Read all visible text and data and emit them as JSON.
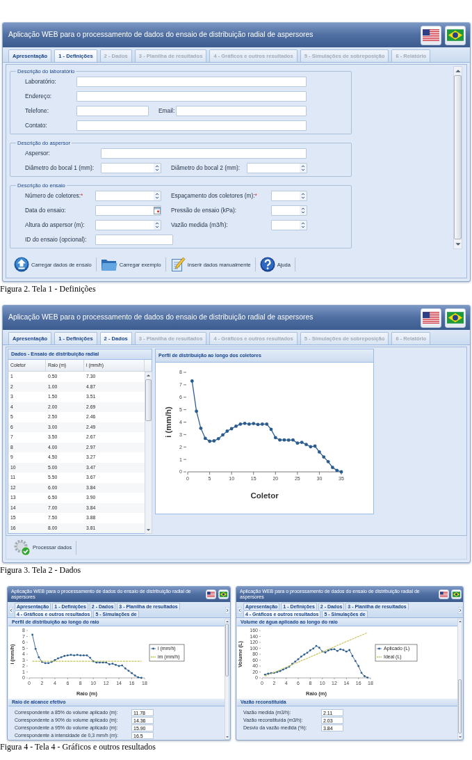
{
  "figures": [
    {
      "kind": "form",
      "window": {
        "title": "Aplicação WEB para o processamento de dados do ensaio de distribuição radial de aspersores"
      },
      "tabs": [
        {
          "label": "Apresentação",
          "selected": false,
          "disabled": false
        },
        {
          "label": "1 - Definições",
          "selected": true,
          "disabled": false
        },
        {
          "label": "2 - Dados",
          "selected": false,
          "disabled": true
        },
        {
          "label": "3 - Planilha de resultados",
          "selected": false,
          "disabled": true
        },
        {
          "label": "4 - Gráficos e outros resultados",
          "selected": false,
          "disabled": true
        },
        {
          "label": "5 - Simulações de sobreposição",
          "selected": false,
          "disabled": true
        },
        {
          "label": "6 - Relatório",
          "selected": false,
          "disabled": true
        }
      ],
      "fieldsets": [
        {
          "legend": "Descrição do laboratório",
          "rows": [
            [
              {
                "label": "Laboratório:",
                "kind": "text"
              }
            ],
            [
              {
                "label": "Endereço:",
                "kind": "text"
              }
            ],
            [
              {
                "label": "Telefone:",
                "kind": "text"
              },
              {
                "label": "Email:",
                "kind": "text"
              }
            ],
            [
              {
                "label": "Contato:",
                "kind": "text"
              }
            ]
          ]
        },
        {
          "legend": "Descrição do aspersor",
          "rows": [
            [
              {
                "label": "Aspersor:",
                "kind": "text"
              }
            ],
            [
              {
                "label": "Diâmetro do bocal 1 (mm):",
                "kind": "spinner"
              },
              {
                "label": "Diâmetro do bocal 2 (mm):",
                "kind": "spinner"
              }
            ]
          ]
        },
        {
          "legend": "Descrição do ensaio",
          "rows": [
            [
              {
                "label": "Número de coletores:",
                "required_mark": "*",
                "kind": "spinner"
              },
              {
                "label": "Espaçamento dos coletores (m):",
                "required_mark": "*",
                "kind": "spinner"
              }
            ],
            [
              {
                "label": "Data do ensaio:",
                "kind": "date"
              },
              {
                "label": "Pressão de ensaio (kPa):",
                "kind": "spinner"
              }
            ],
            [
              {
                "label": "Altura do aspersor (m):",
                "kind": "spinner"
              },
              {
                "label": "Vazão medida (m3/h):",
                "kind": "spinner"
              }
            ],
            [
              {
                "label": "ID do ensaio (opcional):",
                "kind": "text"
              }
            ]
          ]
        }
      ],
      "toolbar": [
        "Carregar dados de ensaio",
        "Carregar exemplo",
        "Inserir dados manualmente",
        "Ajuda"
      ],
      "caption": "Figura 2. Tela 1 - Definições"
    },
    {
      "kind": "data",
      "window": {
        "title": "Aplicação WEB para o processamento de dados do ensaio de distribuição radial de aspersores"
      },
      "tabs": [
        {
          "label": "Apresentação",
          "selected": false,
          "disabled": false
        },
        {
          "label": "1 - Definições",
          "selected": false,
          "disabled": false
        },
        {
          "label": "2 - Dados",
          "selected": true,
          "disabled": false
        },
        {
          "label": "3 - Planilha de resultados",
          "selected": false,
          "disabled": true
        },
        {
          "label": "4 - Gráficos e outros resultados",
          "selected": false,
          "disabled": true
        },
        {
          "label": "5 - Simulações de sobreposição",
          "selected": false,
          "disabled": true
        },
        {
          "label": "6 - Relatório",
          "selected": false,
          "disabled": true
        }
      ],
      "data_grid": {
        "title": "Dados - Ensaio de distribuição radial",
        "columns": [
          "Coletor",
          "Raio (m)",
          "i (mm/h)"
        ],
        "rows": [
          [
            "1",
            "0.50",
            "7.30"
          ],
          [
            "2",
            "1.00",
            "4.87"
          ],
          [
            "3",
            "1.50",
            "3.51"
          ],
          [
            "4",
            "2.00",
            "2.69"
          ],
          [
            "5",
            "2.50",
            "2.46"
          ],
          [
            "6",
            "3.00",
            "2.49"
          ],
          [
            "7",
            "3.50",
            "2.67"
          ],
          [
            "8",
            "4.00",
            "2.97"
          ],
          [
            "9",
            "4.50",
            "3.27"
          ],
          [
            "10",
            "5.00",
            "3.47"
          ],
          [
            "11",
            "5.50",
            "3.67"
          ],
          [
            "12",
            "6.00",
            "3.84"
          ],
          [
            "13",
            "6.50",
            "3.90"
          ],
          [
            "14",
            "7.00",
            "3.84"
          ],
          [
            "15",
            "7.50",
            "3.88"
          ],
          [
            "16",
            "8.00",
            "3.81"
          ]
        ]
      },
      "chart_panel": {
        "title": "Perfil de distribuição ao longo dos coletores",
        "chart_data": {
          "type": "line",
          "xlabel": "Coletor",
          "ylabel": "i (mm/h)",
          "x": [
            1,
            2,
            3,
            4,
            5,
            6,
            7,
            8,
            9,
            10,
            11,
            12,
            13,
            14,
            15,
            16,
            17,
            18,
            19,
            20,
            21,
            22,
            23,
            24,
            25,
            26,
            27,
            28,
            29,
            30,
            31,
            32,
            33,
            34,
            35
          ],
          "series": [
            {
              "color": "#2b5c8f",
              "values": [
                7.3,
                4.87,
                3.51,
                2.69,
                2.46,
                2.49,
                2.67,
                2.97,
                3.27,
                3.47,
                3.67,
                3.84,
                3.9,
                3.84,
                3.88,
                3.81,
                3.84,
                3.84,
                3.42,
                2.75,
                2.56,
                2.56,
                2.55,
                2.56,
                2.31,
                2.37,
                2.2,
                2.02,
                2.07,
                1.6,
                1.2,
                0.82,
                0.35,
                0.12,
                0
              ]
            }
          ],
          "xlim": [
            0,
            35
          ],
          "ylim": [
            0,
            8
          ],
          "xticks": [
            0,
            5,
            10,
            15,
            20,
            25,
            30,
            35
          ],
          "yticks": [
            0,
            1,
            2,
            3,
            4,
            5,
            6,
            7,
            8
          ]
        }
      },
      "toolbar": [
        "Processar dados"
      ],
      "caption": "Figura 3. Tela 2 - Dados"
    },
    {
      "kind": "charts",
      "screens": [
        {
          "window": {
            "title": "Aplicação WEB para o processamento de dados do ensaio de distribuição radial de aspersores"
          },
          "tabs": [
            {
              "label": "Apresentação",
              "selected": false,
              "disabled": false
            },
            {
              "label": "1 - Definições",
              "selected": false,
              "disabled": false
            },
            {
              "label": "2 - Dados",
              "selected": false,
              "disabled": false
            },
            {
              "label": "3 - Planilha de resultados",
              "selected": false,
              "disabled": false
            },
            {
              "label": "4 - Gráficos e outros resultados",
              "selected": true,
              "disabled": false
            },
            {
              "label": "5 - Simulações de",
              "selected": false,
              "disabled": false
            }
          ],
          "chart_panel": {
            "title": "Perfil de distribuição ao longo do raio",
            "chart_data": {
              "type": "line",
              "xlabel": "Raio (m)",
              "ylabel": "i (mm/h)",
              "x": [
                0.5,
                1,
                1.5,
                2,
                2.5,
                3,
                3.5,
                4,
                4.5,
                5,
                5.5,
                6,
                6.5,
                7,
                7.5,
                8,
                8.5,
                9,
                9.5,
                10,
                10.5,
                11,
                11.5,
                12,
                12.5,
                13,
                13.5,
                14,
                14.5,
                15,
                15.5,
                16,
                16.5,
                17,
                17.5
              ],
              "series": [
                {
                  "name": "i (mm/h)",
                  "color": "#2b5c8f",
                  "values": [
                    7.3,
                    4.9,
                    3.5,
                    2.7,
                    2.5,
                    2.5,
                    2.7,
                    3.0,
                    3.3,
                    3.5,
                    3.7,
                    3.8,
                    3.9,
                    3.8,
                    3.9,
                    3.8,
                    3.8,
                    3.8,
                    3.4,
                    2.8,
                    2.6,
                    2.6,
                    2.6,
                    2.6,
                    2.3,
                    2.4,
                    2.2,
                    2.0,
                    2.1,
                    1.6,
                    1.2,
                    0.8,
                    0.4,
                    0.1,
                    0
                  ]
                },
                {
                  "name": "im (mm/h)",
                  "color": "#c2c24e",
                  "line_style": "dashed",
                  "values": [
                    2.8,
                    2.8,
                    2.8,
                    2.8,
                    2.8,
                    2.8,
                    2.8,
                    2.8,
                    2.8,
                    2.8,
                    2.8,
                    2.8,
                    2.8,
                    2.8,
                    2.8,
                    2.8,
                    2.8,
                    2.8,
                    2.8,
                    2.8,
                    2.8,
                    2.8,
                    2.8,
                    2.8,
                    2.8,
                    2.8,
                    2.8,
                    2.8,
                    2.8,
                    2.8,
                    2.8,
                    2.8,
                    2.8,
                    2.8,
                    2.8
                  ]
                }
              ],
              "xlim": [
                0,
                18
              ],
              "ylim": [
                0,
                8
              ],
              "xticks": [
                0,
                2,
                4,
                6,
                8,
                10,
                12,
                14,
                16,
                18
              ],
              "yticks": [
                0,
                1,
                2,
                3,
                4,
                5,
                6,
                7,
                8
              ],
              "legend": "right"
            }
          },
          "results_panel": {
            "title": "Raio de alcance efetivo",
            "fields": [
              {
                "label": "Correspondente a 85% do volume aplicado (m):",
                "value": "11.78"
              },
              {
                "label": "Correspondente a 90% do volume aplicado (m):",
                "value": "14.36"
              },
              {
                "label": "Correspondente a 95% do volume aplicado (m):",
                "value": "15.90"
              },
              {
                "label": "Correspondente à intensidade de 0,3 mm/h (m):",
                "value": "16.5"
              }
            ]
          }
        },
        {
          "window": {
            "title": "Aplicação WEB para o processamento de dados do ensaio de distribuição radial de aspersores"
          },
          "tabs": [
            {
              "label": "Apresentação",
              "selected": false,
              "disabled": false
            },
            {
              "label": "1 - Definições",
              "selected": false,
              "disabled": false
            },
            {
              "label": "2 - Dados",
              "selected": false,
              "disabled": false
            },
            {
              "label": "3 - Planilha de resultados",
              "selected": false,
              "disabled": false
            },
            {
              "label": "4 - Gráficos e outros resultados",
              "selected": true,
              "disabled": false
            },
            {
              "label": "5 - Simulações de",
              "selected": false,
              "disabled": false
            }
          ],
          "chart_panel": {
            "title": "Volume de água aplicado ao longo do raio",
            "chart_data": {
              "type": "line",
              "xlabel": "Raio (m)",
              "ylabel": "Volume (L)",
              "x": [
                0.5,
                1,
                1.5,
                2,
                2.5,
                3,
                3.5,
                4,
                4.5,
                5,
                5.5,
                6,
                6.5,
                7,
                7.5,
                8,
                8.5,
                9,
                9.5,
                10,
                10.5,
                11,
                11.5,
                12,
                12.5,
                13,
                13.5,
                14,
                14.5,
                15,
                15.5,
                16,
                16.5,
                17,
                17.5
              ],
              "series": [
                {
                  "name": "Aplicado (L)",
                  "color": "#2b5c8f",
                  "values": [
                    11,
                    14,
                    16,
                    17,
                    20,
                    23,
                    28,
                    33,
                    38,
                    47,
                    55,
                    63,
                    72,
                    79,
                    85,
                    93,
                    99,
                    108,
                    102,
                    89,
                    86,
                    93,
                    96,
                    97,
                    91,
                    97,
                    94,
                    89,
                    94,
                    74,
                    57,
                    40,
                    17,
                    6,
                    1
                  ]
                },
                {
                  "name": "Ideal (L)",
                  "color": "#c8c35a",
                  "line_style": "dashed",
                  "values": [
                    6,
                    10,
                    14,
                    19,
                    23,
                    27,
                    32,
                    36,
                    40,
                    45,
                    49,
                    53,
                    58,
                    62,
                    66,
                    71,
                    75,
                    79,
                    84,
                    88,
                    92,
                    97,
                    101,
                    105,
                    110,
                    114,
                    118,
                    123,
                    127,
                    131,
                    136,
                    140,
                    144,
                    149,
                    153
                  ]
                }
              ],
              "xlim": [
                0,
                18
              ],
              "ylim": [
                0,
                160
              ],
              "xticks": [
                0,
                2,
                4,
                6,
                8,
                10,
                12,
                14,
                16,
                18
              ],
              "yticks": [
                0,
                20,
                40,
                60,
                80,
                100,
                120,
                140,
                160
              ],
              "legend": "right"
            }
          },
          "results_panel": {
            "title": "Vazão reconstituída",
            "fields": [
              {
                "label": "Vazão medida (m3/h):",
                "value": "2.11"
              },
              {
                "label": "Vazão reconstituída (m3/h):",
                "value": "2.03"
              },
              {
                "label": "Desvio da vazão medida (%):",
                "value": "3.84"
              }
            ]
          }
        }
      ],
      "caption": "Figura 4 - Tela 4 - Gráficos e outros resultados"
    }
  ]
}
